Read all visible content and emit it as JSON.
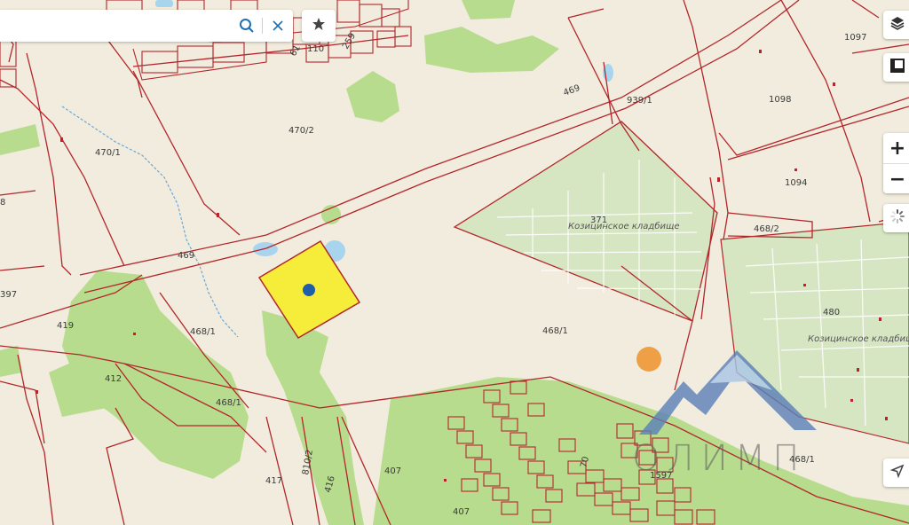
{
  "search": {
    "placeholder": "",
    "value": ""
  },
  "icons": {
    "search": "search-icon",
    "clear": "close-icon",
    "favorite": "star-icon",
    "layers": "layers-icon",
    "panel": "panel-toggle-icon",
    "loading": "spinner-icon",
    "locate": "navigation-arrow-icon"
  },
  "controls": {
    "zoom_in": "+",
    "zoom_out": "−"
  },
  "parcels": {
    "p1097": "1097",
    "p1098": "1098",
    "p1094": "1094",
    "p939_1": "939/1",
    "p470_2": "470/2",
    "p470_1": "470/1",
    "p469_top": "469",
    "p469_left": "469",
    "p468_2": "468/2",
    "p371": "371",
    "p480": "480",
    "p468_1_center": "468/1",
    "p468_1_left": "468/1",
    "p468_1_bottom": "468/1",
    "p468_1_right": "468/1",
    "p419": "419",
    "p412": "412",
    "p417": "417",
    "p416": "416",
    "p810_2": "810/2",
    "p407_a": "407",
    "p407_b": "407",
    "p397": "397",
    "p8": "8",
    "p110": "110",
    "p259": "259",
    "p61": "61",
    "p70": "70",
    "p1597": "1597"
  },
  "places": {
    "cemetery_1": "Козицинское кладбище",
    "cemetery_2": "Козицинское кладбище"
  },
  "colors": {
    "base": "#f1ecdd",
    "green": "#b8dc8e",
    "cemetery": "#d7e6c2",
    "boundary": "#b3262b",
    "selected": "#f6ec3a",
    "marker_blue": "#1f5ea8",
    "marker_orange": "#efa046",
    "watermark": "#5a7fb8"
  },
  "watermark": {
    "text": "ОЛИМП"
  }
}
